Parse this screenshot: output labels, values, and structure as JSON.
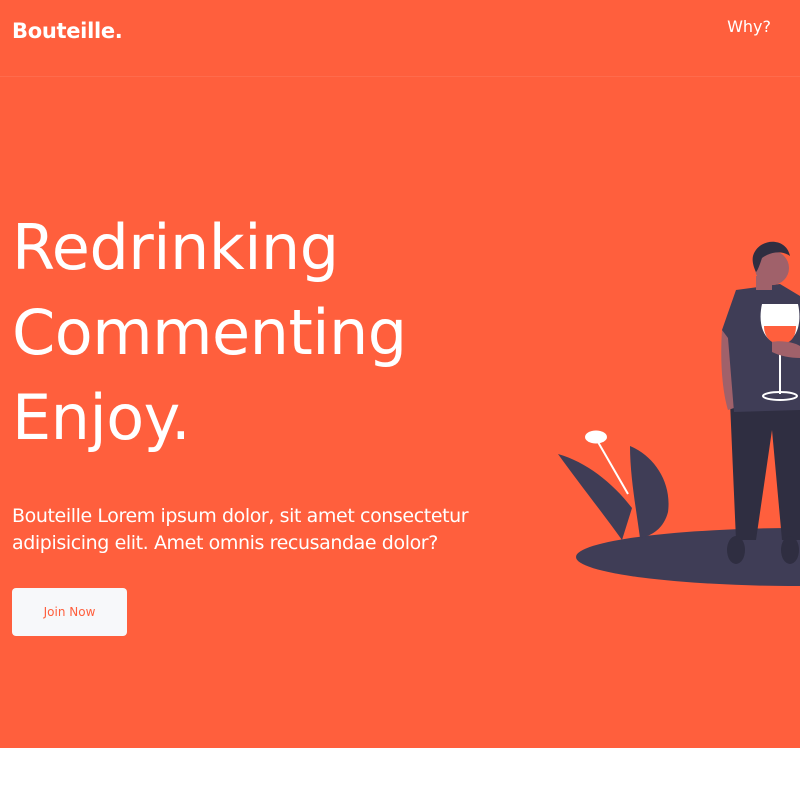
{
  "navbar": {
    "brand": "Bouteille.",
    "link": "Why?"
  },
  "hero": {
    "headline_lines": [
      "Redrinking",
      "Commenting",
      "Enjoy."
    ],
    "description": "Bouteille Lorem ipsum dolor, sit amet consectetur adipisicing elit. Amet omnis recusandae dolor?",
    "cta_label": "Join Now"
  },
  "colors": {
    "hero_background": "#ff5f3d",
    "text": "#ffffff",
    "button_background": "#f7f8fa",
    "button_text": "#ff5f3d",
    "illustration_dark": "#3f3d56",
    "illustration_skin": "#a0616a"
  }
}
